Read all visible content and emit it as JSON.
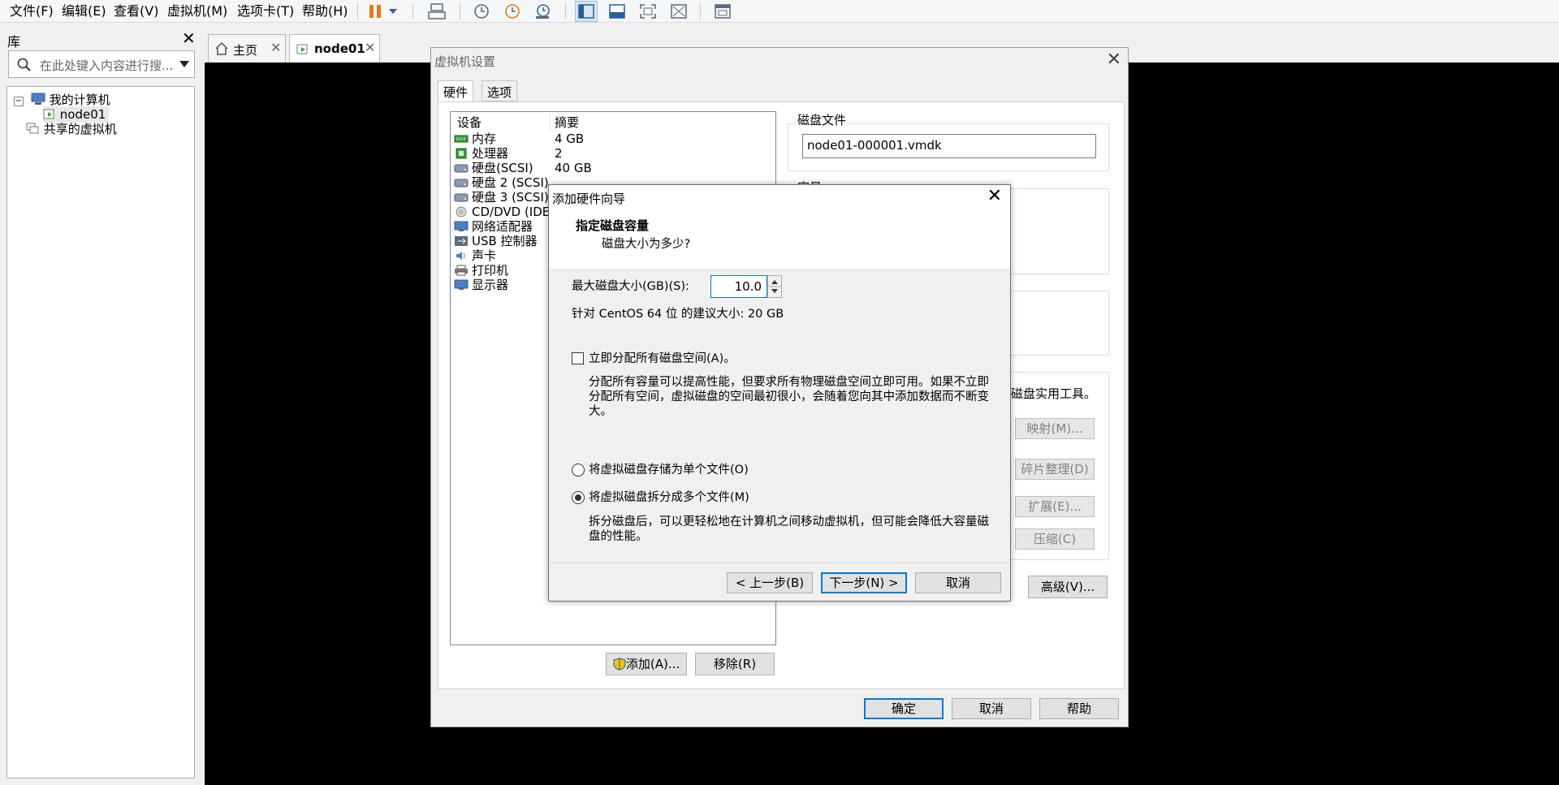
{
  "menu": {
    "items": [
      "文件(F)",
      "编辑(E)",
      "查看(V)",
      "虚拟机(M)",
      "选项卡(T)",
      "帮助(H)"
    ]
  },
  "library": {
    "title": "库",
    "search_placeholder": "在此处键入内容进行搜...",
    "tree": {
      "my_computer": "我的计算机",
      "vm": "node01",
      "shared": "共享的虚拟机"
    }
  },
  "tabs": {
    "home": "主页",
    "vm": "node01"
  },
  "settings": {
    "title": "虚拟机设置",
    "tabs": {
      "hardware": "硬件",
      "options": "选项"
    },
    "columns": {
      "device": "设备",
      "summary": "摘要"
    },
    "devices": [
      {
        "name": "内存",
        "summary": "4 GB",
        "icon": "memory-icon"
      },
      {
        "name": "处理器",
        "summary": "2",
        "icon": "cpu-icon"
      },
      {
        "name": "硬盘(SCSI)",
        "summary": "40 GB",
        "icon": "harddisk-icon"
      },
      {
        "name": "硬盘 2 (SCSI)",
        "summary": "",
        "icon": "harddisk-icon"
      },
      {
        "name": "硬盘 3 (SCSI)",
        "summary": "",
        "icon": "harddisk-icon"
      },
      {
        "name": "CD/DVD (IDE)",
        "summary": "",
        "icon": "cd-icon"
      },
      {
        "name": "网络适配器",
        "summary": "",
        "icon": "network-icon"
      },
      {
        "name": "USB 控制器",
        "summary": "",
        "icon": "usb-icon"
      },
      {
        "name": "声卡",
        "summary": "",
        "icon": "sound-icon"
      },
      {
        "name": "打印机",
        "summary": "",
        "icon": "printer-icon"
      },
      {
        "name": "显示器",
        "summary": "",
        "icon": "display-icon"
      }
    ],
    "disk_file_label": "磁盘文件",
    "disk_file_value": "node01-000001.vmdk",
    "capacity_label": "容量",
    "utility_text": "磁盘实用工具。",
    "buttons": {
      "map": "映射(M)...",
      "defrag": "碎片整理(D)",
      "expand": "扩展(E)...",
      "compact": "压缩(C)",
      "advanced": "高级(V)...",
      "add": "添加(A)...",
      "remove": "移除(R)",
      "ok": "确定",
      "cancel": "取消",
      "help": "帮助"
    }
  },
  "wizard": {
    "title": "添加硬件向导",
    "heading": "指定磁盘容量",
    "subheading": "磁盘大小为多少?",
    "size_label": "最大磁盘大小(GB)(S):",
    "size_value": "10.0",
    "recommend": "针对 CentOS 64 位 的建议大小: 20 GB",
    "allocate_label": "立即分配所有磁盘空间(A)。",
    "allocate_checked": false,
    "allocate_desc": "分配所有容量可以提高性能，但要求所有物理磁盘空间立即可用。如果不立即分配所有空间，虚拟磁盘的空间最初很小，会随着您向其中添加数据而不断变大。",
    "single_file_label": "将虚拟磁盘存储为单个文件(O)",
    "multi_file_label": "将虚拟磁盘拆分成多个文件(M)",
    "selected_option": "multi",
    "multi_desc": "拆分磁盘后，可以更轻松地在计算机之间移动虚拟机，但可能会降低大容量磁盘的性能。",
    "buttons": {
      "back": "< 上一步(B)",
      "next": "下一步(N) >",
      "cancel": "取消"
    }
  },
  "colors": {
    "accent": "#0078d7",
    "pause": "#e07b1f"
  }
}
